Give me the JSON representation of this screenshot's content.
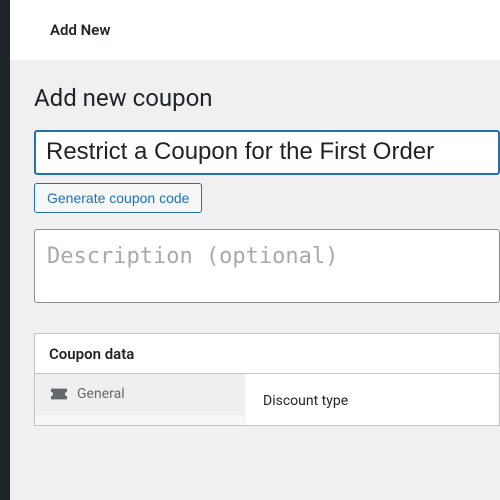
{
  "topbar": {
    "title": "Add New"
  },
  "page": {
    "heading": "Add new coupon"
  },
  "coupon": {
    "title_value": "Restrict a Coupon for the First Order",
    "generate_label": "Generate coupon code",
    "description_placeholder": "Description (optional)"
  },
  "panel": {
    "title": "Coupon data",
    "tabs": [
      {
        "label": "General"
      }
    ],
    "fields": {
      "discount_type_label": "Discount type"
    }
  }
}
